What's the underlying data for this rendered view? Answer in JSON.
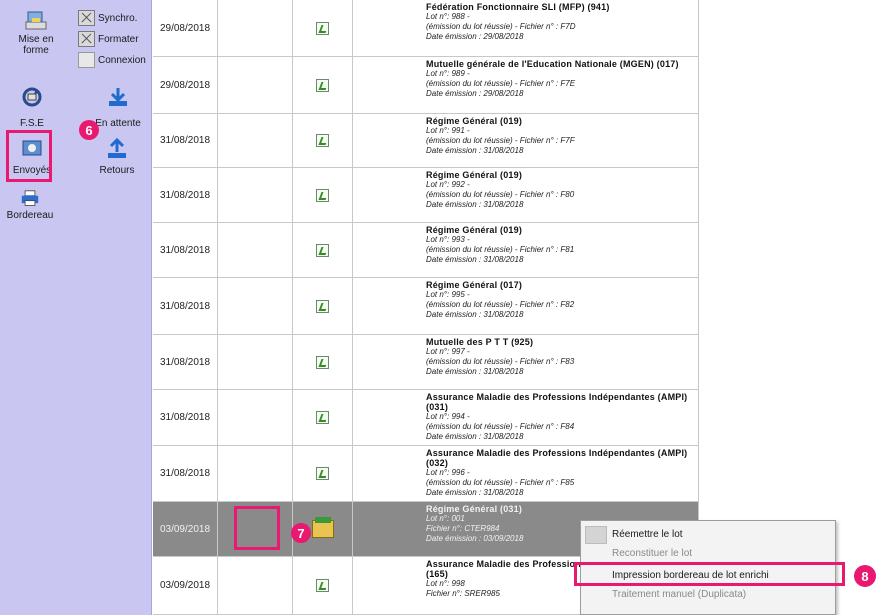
{
  "sidebar": {
    "mise_en_forme": "Mise en forme",
    "synchro": "Synchro.",
    "formater": "Formater",
    "connexion": "Connexion",
    "fse": "F.S.E",
    "en_attente": "En attente",
    "envoyes": "Envoyés",
    "retours": "Retours",
    "bordereau": "Bordereau"
  },
  "badges": {
    "b6": "6",
    "b7": "7",
    "b8": "8"
  },
  "rows": [
    {
      "date": "29/08/2018",
      "title": "Fédération Fonctionnaire SLI (MFP) (941)",
      "l1": "Lot n°: 988 -",
      "l2": "(émission du lot réussie) - Fichier n° : F7D",
      "l3": "Date émission : 29/08/2018"
    },
    {
      "date": "29/08/2018",
      "title": "Mutuelle générale de l'Education Nationale (MGEN) (017)",
      "l1": "Lot n°: 989 -",
      "l2": "(émission du lot réussie) - Fichier n° : F7E",
      "l3": "Date émission : 29/08/2018"
    },
    {
      "date": "31/08/2018",
      "title": "Régime Général (019)",
      "l1": "Lot n°: 991 -",
      "l2": "(émission du lot réussie) - Fichier n° : F7F",
      "l3": "Date émission : 31/08/2018"
    },
    {
      "date": "31/08/2018",
      "title": "Régime Général (019)",
      "l1": "Lot n°: 992 -",
      "l2": "(émission du lot réussie) - Fichier n° : F80",
      "l3": "Date émission : 31/08/2018"
    },
    {
      "date": "31/08/2018",
      "title": "Régime Général (019)",
      "l1": "Lot n°: 993 -",
      "l2": "(émission du lot réussie) - Fichier n° : F81",
      "l3": "Date émission : 31/08/2018"
    },
    {
      "date": "31/08/2018",
      "title": "Régime Général (017)",
      "l1": "Lot n°: 995 -",
      "l2": "(émission du lot réussie) - Fichier n° : F82",
      "l3": "Date émission : 31/08/2018"
    },
    {
      "date": "31/08/2018",
      "title": "Mutuelle des P T T (925)",
      "l1": "Lot n°: 997 -",
      "l2": "(émission du lot réussie) - Fichier n° : F83",
      "l3": "Date émission : 31/08/2018"
    },
    {
      "date": "31/08/2018",
      "title": "Assurance Maladie des Professions Indépendantes (AMPI) (031)",
      "l1": "Lot n°: 994 -",
      "l2": "(émission du lot réussie) - Fichier n° : F84",
      "l3": "Date émission : 31/08/2018"
    },
    {
      "date": "31/08/2018",
      "title": "Assurance Maladie des Professions Indépendantes (AMPI) (032)",
      "l1": "Lot n°: 996 -",
      "l2": "(émission du lot réussie) - Fichier n° : F85",
      "l3": "Date émission : 31/08/2018"
    },
    {
      "date": "03/09/2018",
      "title": "Régime Général (031)",
      "l1": "Lot n°: 001",
      "l2": "Fichier n°: CTER984",
      "l3": "Date émission : 03/09/2018"
    },
    {
      "date": "03/09/2018",
      "title": "Assurance Maladie des Professions Indépendantes (AMPI) (165)",
      "l1": "Lot n°: 998",
      "l2": "Fichier n°: SRER985",
      "l3": ""
    }
  ],
  "context_menu": {
    "items": [
      "Réemettre le lot",
      "Reconstituer le lot",
      "Impression bordereau de lot enrichi",
      "Traitement manuel (Duplicata)"
    ]
  }
}
